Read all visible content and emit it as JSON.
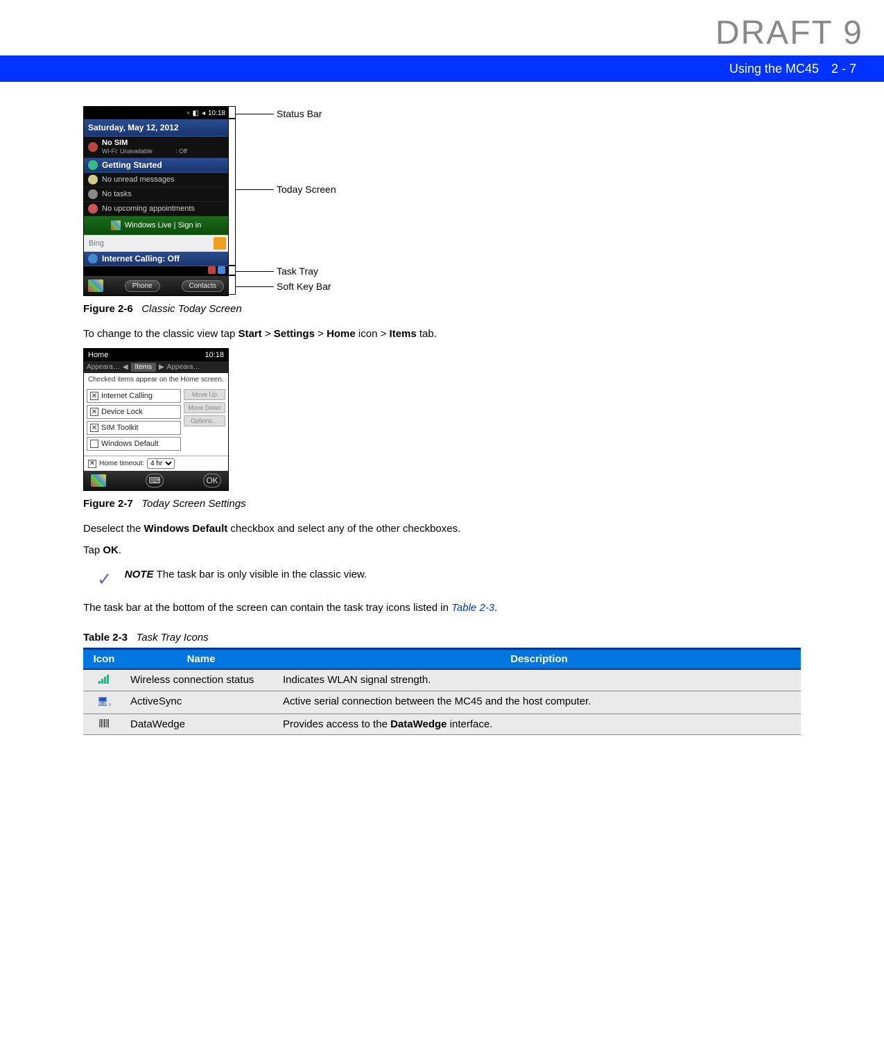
{
  "watermark": "DRAFT 9",
  "header": {
    "title": "Using the MC45",
    "pagenum": "2 - 7"
  },
  "fig26": {
    "statusbar_time": "10:18",
    "date": "Saturday, May 12, 2012",
    "nosim": {
      "title": "No SIM",
      "wifi": "Wi-Fi: Unavailable",
      "bt": ": Off"
    },
    "gs": "Getting Started",
    "unread": "No unread messages",
    "tasks": "No tasks",
    "appt": "No upcoming appointments",
    "wlive": "Windows Live | Sign in",
    "bing_placeholder": "Bing",
    "intcall": "Internet Calling: Off",
    "soft_left": "Phone",
    "soft_right": "Contacts",
    "callouts": {
      "status": "Status Bar",
      "today": "Today Screen",
      "tasktray": "Task Tray",
      "softkey": "Soft Key Bar"
    },
    "caption_label": "Figure 2-6",
    "caption_text": "Classic Today Screen"
  },
  "instr1_prefix": "To change to the classic view tap ",
  "instr1_parts": {
    "start": "Start",
    "settings": "Settings",
    "home": "Home",
    "items": "Items"
  },
  "instr1_suffixes": {
    "gt": " > ",
    "icon": " icon > ",
    "tab": " tab."
  },
  "fig27": {
    "title": "Home",
    "time": "10:18",
    "tab_left": "Appeara…",
    "tab_center": "Items",
    "tab_right": "Appeara…",
    "hint": "Checked items appear on the Home screen.",
    "items": [
      "Internet Calling",
      "Device Lock",
      "SIM Toolkit",
      "Windows Default"
    ],
    "checked": [
      true,
      true,
      true,
      false
    ],
    "btn_up": "Move Up",
    "btn_down": "Move Down",
    "btn_opt": "Options…",
    "timeout_label": "Home timeout:",
    "timeout_val": "4 hr",
    "ok": "OK",
    "caption_label": "Figure 2-7",
    "caption_text": "Today Screen Settings"
  },
  "instr2_prefix": "Deselect the ",
  "instr2_bold": "Windows Default",
  "instr2_suffix": " checkbox and select any of the other checkboxes.",
  "instr3_prefix": "Tap ",
  "instr3_bold": "OK",
  "instr3_suffix": ".",
  "note": {
    "label": "NOTE",
    "text": "The task bar is only visible in the classic view."
  },
  "instr4_prefix": "The task bar at the bottom of the screen can contain the task tray icons listed in ",
  "instr4_link": "Table 2-3",
  "instr4_suffix": ".",
  "table": {
    "caption_label": "Table 2-3",
    "caption_text": "Task Tray Icons",
    "headers": {
      "icon": "Icon",
      "name": "Name",
      "desc": "Description"
    },
    "rows": [
      {
        "name": "Wireless connection status",
        "desc": "Indicates WLAN signal strength."
      },
      {
        "name": "ActiveSync",
        "desc_pre": "Active serial connection between the MC45 and the host computer.",
        "desc_bold": "",
        "desc_post": ""
      },
      {
        "name": "DataWedge",
        "desc_pre": "Provides access to the ",
        "desc_bold": "DataWedge",
        "desc_post": " interface."
      }
    ]
  }
}
